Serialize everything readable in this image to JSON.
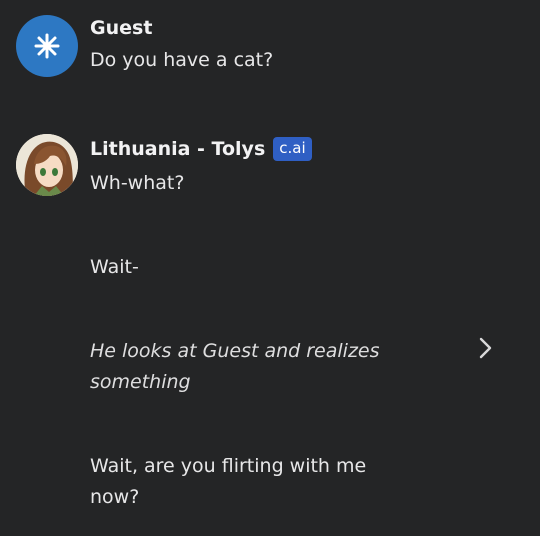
{
  "guest": {
    "name": "Guest",
    "avatar_icon": "snowflake-star-icon",
    "avatar_color": "#2d78c3",
    "message": "Do you have a cat?"
  },
  "character": {
    "name": "Lithuania - Tolys",
    "badge": "c.ai",
    "badge_color": "#2f5fc4",
    "avatar_icon": "character-portrait-icon",
    "messages": {
      "line1": "Wh-what?",
      "line2": "Wait-",
      "line3": "He looks at Guest and realizes something",
      "line4": "Wait, are you flirting with me now?"
    }
  },
  "controls": {
    "next_icon": "chevron-right-icon"
  },
  "colors": {
    "background": "#242526",
    "text": "#e9e9ea"
  }
}
